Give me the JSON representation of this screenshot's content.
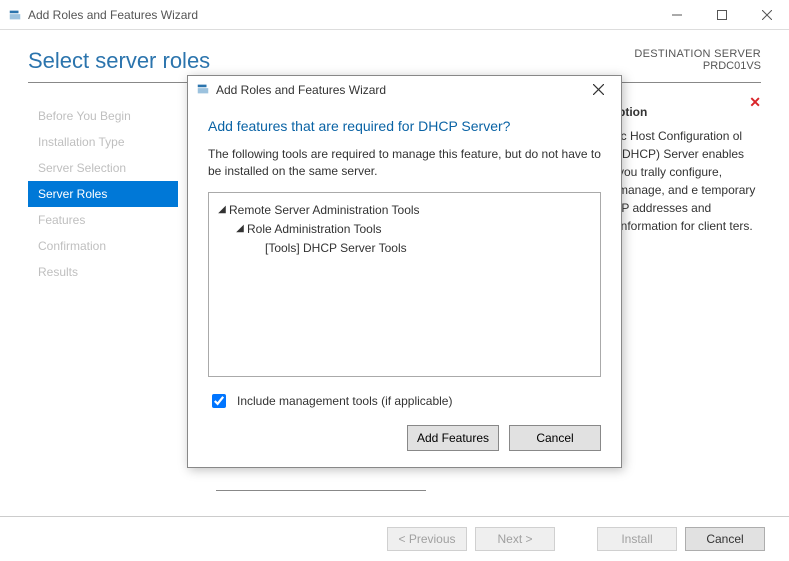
{
  "titlebar": {
    "title": "Add Roles and Features Wizard"
  },
  "header": {
    "page_title": "Select server roles",
    "dest_label": "DESTINATION SERVER",
    "dest_server": "PRDC01VS"
  },
  "nav": {
    "items": [
      {
        "label": "Before You Begin",
        "active": false
      },
      {
        "label": "Installation Type",
        "active": false
      },
      {
        "label": "Server Selection",
        "active": false
      },
      {
        "label": "Server Roles",
        "active": true
      },
      {
        "label": "Features",
        "active": false
      },
      {
        "label": "Confirmation",
        "active": false
      },
      {
        "label": "Results",
        "active": false
      }
    ]
  },
  "description": {
    "title_fragment": "ption",
    "body_fragment": "ic Host Configuration ol (DHCP) Server enables you trally configure, manage, and e temporary IP addresses and information for client ters."
  },
  "footer": {
    "previous": "< Previous",
    "next": "Next >",
    "install": "Install",
    "cancel": "Cancel"
  },
  "modal": {
    "title": "Add Roles and Features Wizard",
    "question": "Add features that are required for DHCP Server?",
    "explain": "The following tools are required to manage this feature, but do not have to be installed on the same server.",
    "tree": {
      "root": "Remote Server Administration Tools",
      "child": "Role Administration Tools",
      "leaf": "[Tools] DHCP Server Tools"
    },
    "include_label": "Include management tools (if applicable)",
    "include_checked": true,
    "add_features": "Add Features",
    "cancel": "Cancel"
  }
}
